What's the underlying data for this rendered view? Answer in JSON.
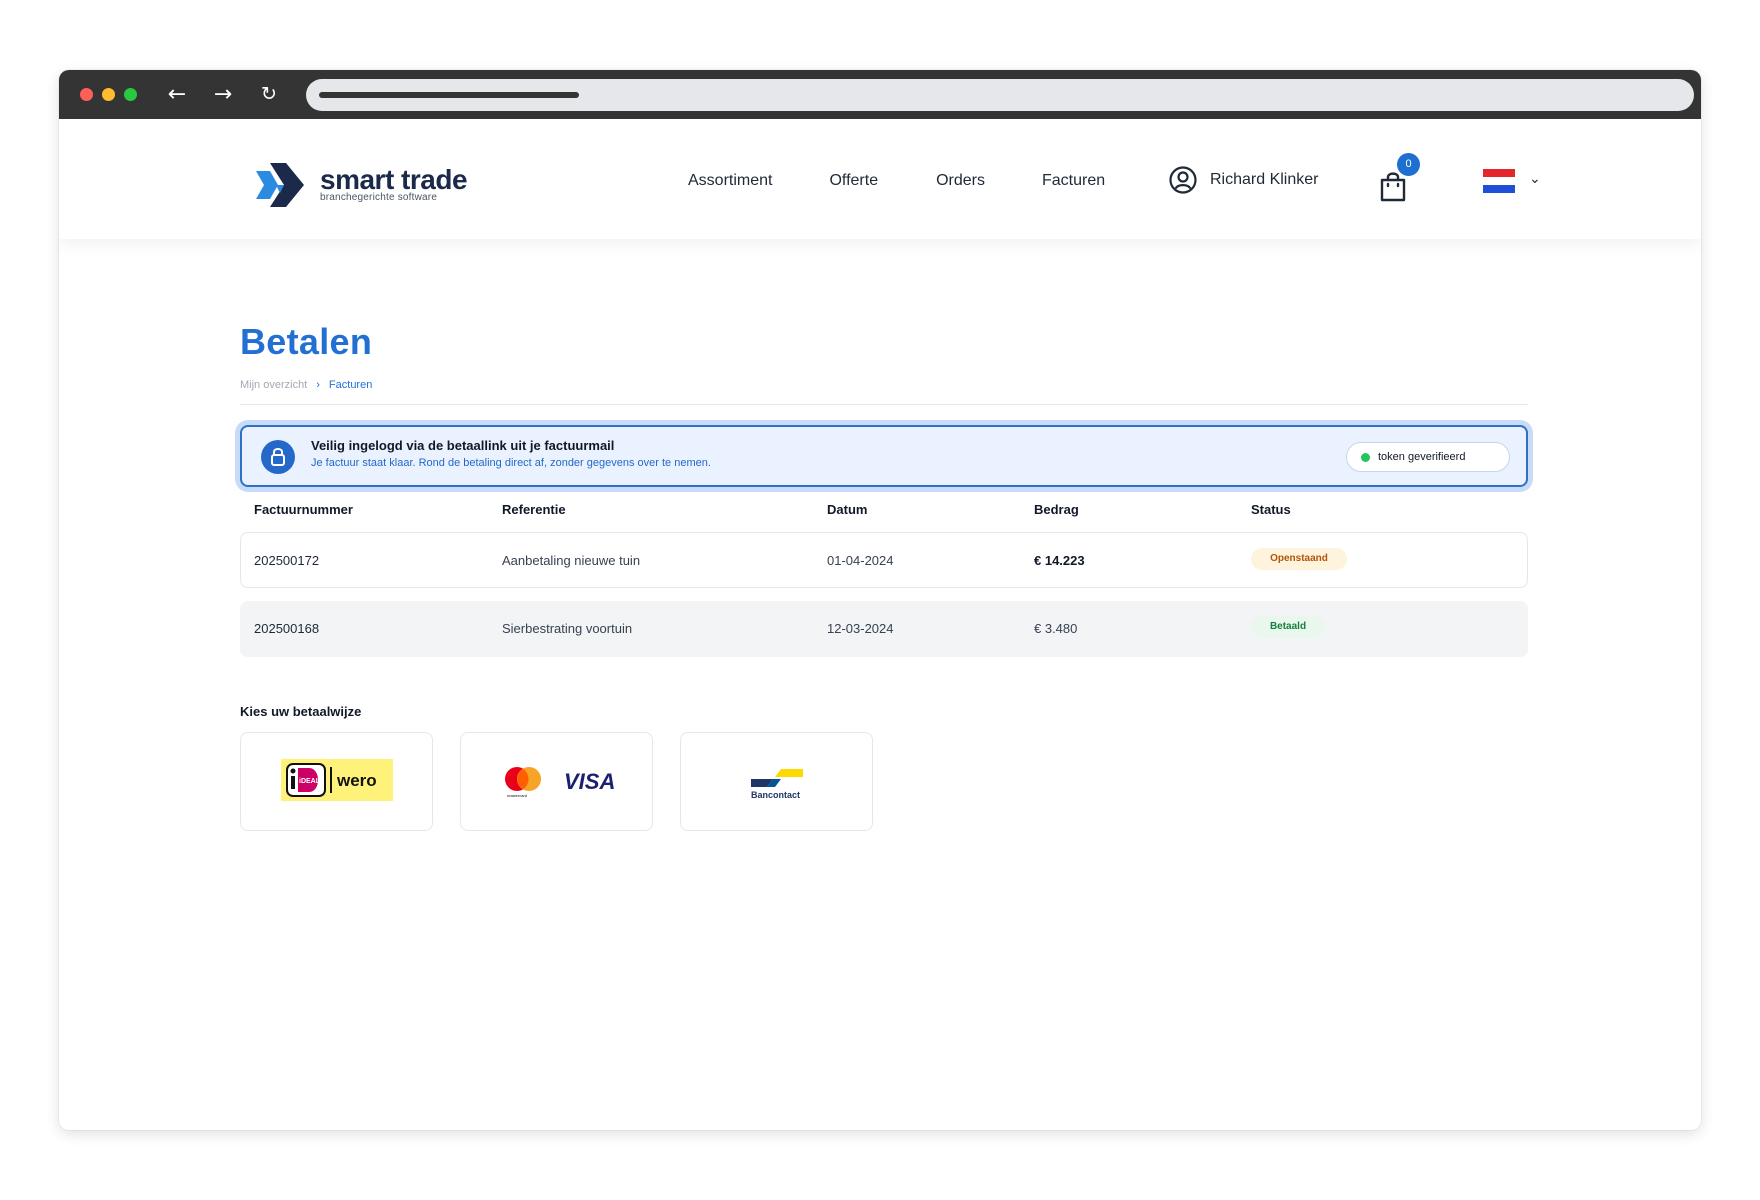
{
  "header": {
    "logo": {
      "name": "smart trade",
      "tagline": "branchegerichte software"
    },
    "menu": [
      {
        "label": "Assortiment"
      },
      {
        "label": "Offerte"
      },
      {
        "label": "Orders"
      },
      {
        "label": "Facturen"
      }
    ],
    "user": {
      "name": "Richard Klinker",
      "icon": "user-circle-icon"
    },
    "cart": {
      "count": "0",
      "icon": "shopping-bag-icon"
    },
    "language": {
      "flag": "nl-flag",
      "colors": [
        "#e4252c",
        "#ffffff",
        "#1f4fd8"
      ]
    }
  },
  "page": {
    "title": "Betalen",
    "breadcrumb": {
      "parent": "Mijn overzicht",
      "separator": "›",
      "current": "Facturen"
    }
  },
  "notice": {
    "icon": "lock-icon",
    "title": "Veilig ingelogd via de betaallink uit je factuurmail",
    "subtitle": "Je factuur staat klaar. Rond de betaling direct af, zonder gegevens over te nemen.",
    "badge": "token geverifieerd"
  },
  "table": {
    "headers": [
      "Factuurnummer",
      "Referentie",
      "Datum",
      "Bedrag",
      "Status"
    ],
    "rows": [
      {
        "number": "202500172",
        "reference": "Aanbetaling nieuwe tuin",
        "date": "01-04-2024",
        "amount": "€ 14.223",
        "status": "Openstaand"
      },
      {
        "number": "202500168",
        "reference": "Sierbestrating voortuin",
        "date": "12-03-2024",
        "amount": "€ 3.480",
        "status": "Betaald"
      }
    ]
  },
  "payment": {
    "title": "Kies uw betaalwijze",
    "methods": [
      {
        "logo_text_1": "iDEAL",
        "logo_text_2": "wero"
      },
      {
        "logo_text_1": "mastercard",
        "logo_text_2": "VISA"
      },
      {
        "logo_text_1": "Bancontact"
      }
    ]
  },
  "colors": {
    "accent": "#2370d3",
    "status_open": "#b45309",
    "status_paid": "#15803d",
    "token_dot": "#22c55e"
  }
}
